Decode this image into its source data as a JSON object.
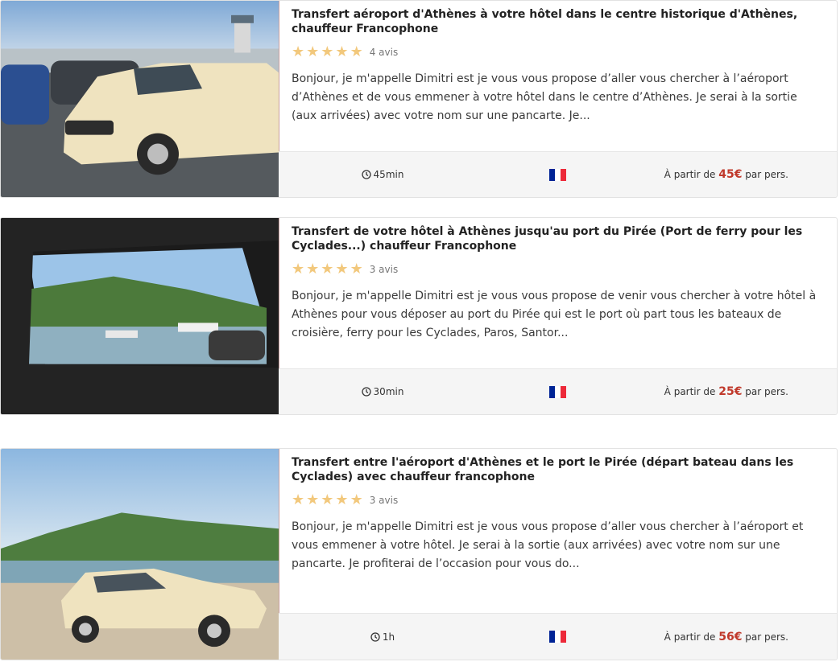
{
  "listings": [
    {
      "title": "Transfert aéroport d'Athènes à votre hôtel dans le centre historique d'Athènes, chauffeur Francophone",
      "reviews": "4 avis",
      "description": "Bonjour, je m'appelle Dimitri est je vous vous propose d’aller vous chercher à l’aéroport d’Athènes et de vous emmener à votre hôtel dans le centre d’Athènes. Je serai à la sortie (aux arrivées) avec votre nom sur une pancarte. Je...",
      "duration": "45min",
      "price_prefix": "À partir de",
      "price": "45€",
      "price_suffix": "par pers.",
      "rating": 5
    },
    {
      "title": "Transfert de votre hôtel à Athènes jusqu'au port du Pirée (Port de ferry pour les Cyclades...) chauffeur Francophone",
      "reviews": "3 avis",
      "description": "Bonjour, je m'appelle Dimitri est je vous vous propose de venir vous chercher à votre hôtel à Athènes pour vous déposer au port du Pirée qui est le port où part tous les bateaux de croisière, ferry pour les Cyclades, Paros, Santor...",
      "duration": "30min",
      "price_prefix": "À partir de",
      "price": "25€",
      "price_suffix": "par pers.",
      "rating": 5
    },
    {
      "title": "Transfert entre l'aéroport d'Athènes et le port le Pirée (départ bateau dans les Cyclades) avec chauffeur francophone",
      "reviews": "3 avis",
      "description": "Bonjour, je m'appelle Dimitri est je vous vous propose d’aller vous chercher à l’aéroport et vous emmener à votre hôtel. Je serai à la sortie (aux arrivées) avec votre nom sur une pancarte. Je profiterai de l’occasion pour vous do...",
      "duration": "1h",
      "price_prefix": "À partir de",
      "price": "56€",
      "price_suffix": "par pers.",
      "rating": 5
    }
  ],
  "colors": {
    "star": "#f2c87c",
    "price": "#c0392b",
    "flag_blue": "#002395",
    "flag_white": "#ffffff",
    "flag_red": "#ed2939"
  },
  "icons": {
    "duration": "clock-icon",
    "language": "french-flag-icon",
    "rating": "star-icon"
  }
}
